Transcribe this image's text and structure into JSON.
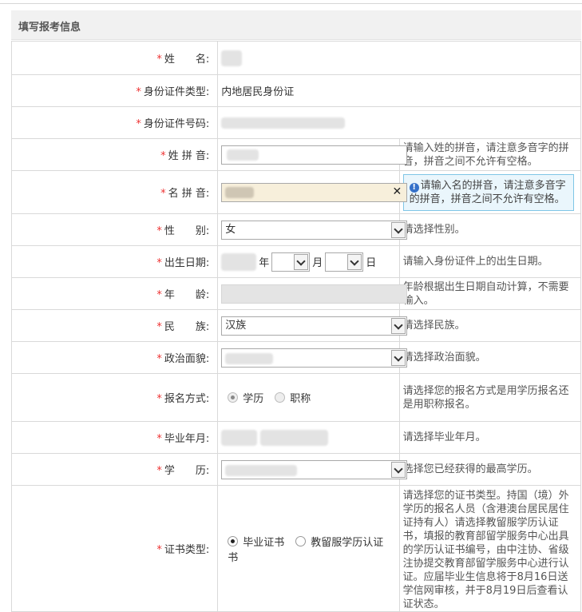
{
  "section": {
    "title": "填写报考信息"
  },
  "rows": {
    "name": {
      "label": "姓　　名:",
      "required": true
    },
    "id_type": {
      "label": "身份证件类型:",
      "value": "内地居民身份证"
    },
    "id_number": {
      "label": "身份证件号码:"
    },
    "surname_pinyin": {
      "label": "姓 拼 音:",
      "tip": "请输入姓的拼音，请注意多音字的拼音，拼音之间不允许有空格。"
    },
    "given_pinyin": {
      "label": "名 拼 音:",
      "clear": "✕",
      "tip": "请输入名的拼音，请注意多音字的拼音，拼音之间不允许有空格。"
    },
    "gender": {
      "label": "性　　别:",
      "value": "女",
      "tip": "请选择性别。"
    },
    "birth": {
      "label": "出生日期:",
      "year": "年",
      "month": "月",
      "day": "日",
      "tip": "请输入身份证件上的出生日期。"
    },
    "age": {
      "label": "年　　龄:",
      "tip": "年龄根据出生日期自动计算，不需要输入。"
    },
    "ethnicity": {
      "label": "民　　族:",
      "value": "汉族",
      "tip": "请选择民族。"
    },
    "political": {
      "label": "政治面貌:",
      "tip": "请选择政治面貌。"
    },
    "apply_mode": {
      "label": "报名方式:",
      "options": [
        "学历",
        "职称"
      ],
      "selected": 0,
      "tip": "请选择您的报名方式是用学历报名还是用职称报名。"
    },
    "grad_date": {
      "label": "毕业年月:",
      "tip": "请选择毕业年月。"
    },
    "education": {
      "label": "学　　历:",
      "tip": "选择您已经获得的最高学历。"
    },
    "cert_type": {
      "label": "证书类型:",
      "options": [
        "毕业证书",
        "教留服学历认证书"
      ],
      "selected": 0,
      "tip": "请选择您的证书类型。持国（境）外学历的报名人员（含港澳台居民居住证持有人）请选择教留服学历认证书，填报的教育部留学服务中心出具的学历认证书编号，由中注协、省级注协提交教育部留学服务中心进行认证。应届毕业生信息将于8月16日送学信网审核，并于8月19日后查看认证状态。"
    }
  }
}
